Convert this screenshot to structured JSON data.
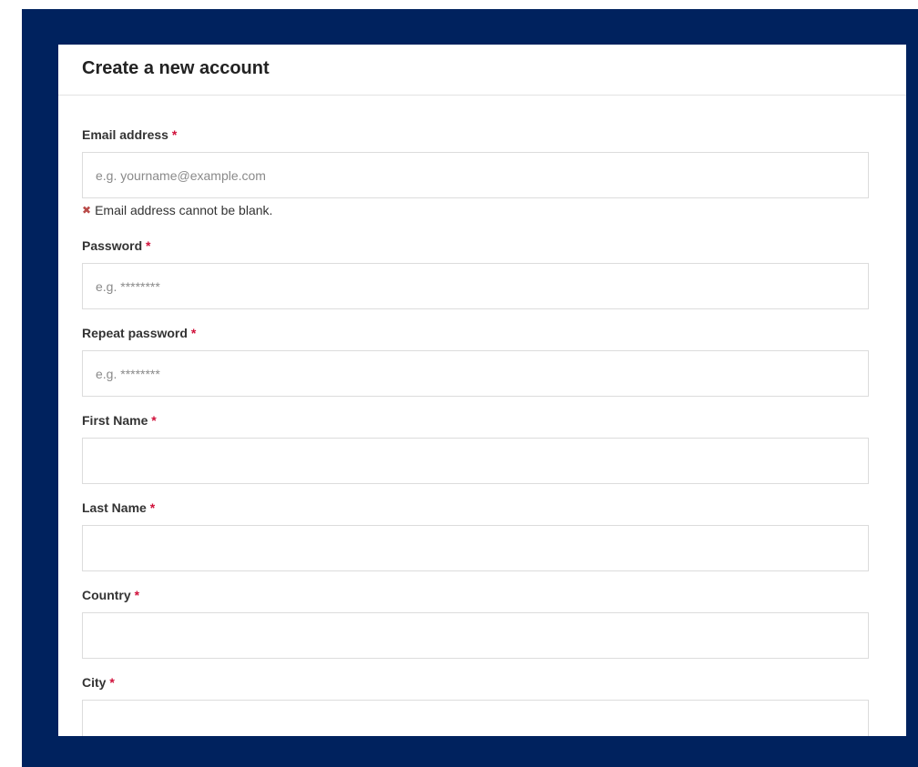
{
  "form": {
    "title": "Create a new account",
    "required_marker": "*",
    "fields": [
      {
        "label": "Email address",
        "placeholder": "e.g. yourname@example.com",
        "error": "Email address cannot be blank."
      },
      {
        "label": "Password",
        "placeholder": "e.g. ********"
      },
      {
        "label": "Repeat password",
        "placeholder": "e.g. ********"
      },
      {
        "label": "First Name",
        "placeholder": ""
      },
      {
        "label": "Last Name",
        "placeholder": ""
      },
      {
        "label": "Country",
        "placeholder": ""
      },
      {
        "label": "City",
        "placeholder": ""
      }
    ]
  },
  "colors": {
    "background": "#00225e",
    "required_marker": "#d0103a",
    "error_icon": "#b94a48"
  },
  "icons": {
    "error_icon": "cross-icon"
  }
}
